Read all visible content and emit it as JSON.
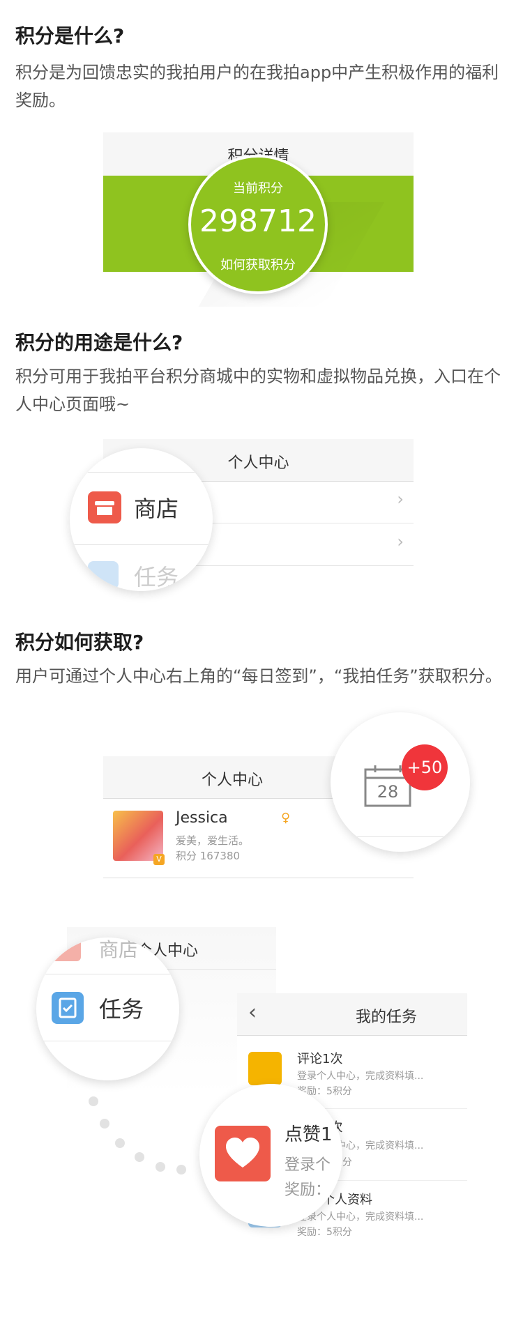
{
  "section1": {
    "title": "积分是什么?",
    "body": "积分是为回馈忠实的我拍用户的在我拍app中产生积极作用的福利奖励。",
    "card": {
      "header": "积分详情",
      "current_label": "当前积分",
      "points": "298712",
      "how_label": "如何获取积分"
    }
  },
  "section2": {
    "title": "积分的用途是什么?",
    "body": "积分可用于我拍平台积分商城中的实物和虚拟物品兑换，入口在个人中心页面哦~",
    "card": {
      "header": "个人中心",
      "store_label": "商店",
      "task_label": "任务"
    }
  },
  "section3": {
    "title": "积分如何获取?",
    "body": "用户可通过个人中心右上角的“每日签到”，“我拍任务”获取积分。",
    "card": {
      "header": "个人中心",
      "user_name": "Jessica",
      "user_bio": "爱美，爱生活。",
      "user_points": "积分 167380",
      "calendar_day": "28",
      "checkin_bonus": "+50"
    }
  },
  "section4": {
    "bg_header": "个人中心",
    "store_label": "商店",
    "task_label": "任务",
    "tasks_title": "我的任务",
    "tasks": [
      {
        "title": "评论1次",
        "desc": "登录个人中心，完成资料填...",
        "reward": "奖励：5积分"
      },
      {
        "title": "点赞1次",
        "desc": "登录个人中心，完成资料填...",
        "reward": "奖励：5积分"
      },
      {
        "title": "完善个人资料",
        "desc": "登录个人中心，完成资料填...",
        "reward": "奖励：5积分"
      }
    ],
    "zoom_like_title": "点赞1",
    "zoom_like_desc": "登录个",
    "zoom_like_reward": "奖励："
  },
  "colors": {
    "green": "#8fc31f",
    "red_store": "#ee5a4a",
    "blue_task": "#5aa6e6",
    "yellow_task": "#f5b400",
    "badge_red": "#f0353b"
  },
  "icons": [
    "store-icon",
    "task-clipboard-icon",
    "calendar-icon",
    "heart-icon",
    "chevron-right-icon",
    "back-arrow-icon",
    "female-gender-icon",
    "verified-badge-icon"
  ]
}
